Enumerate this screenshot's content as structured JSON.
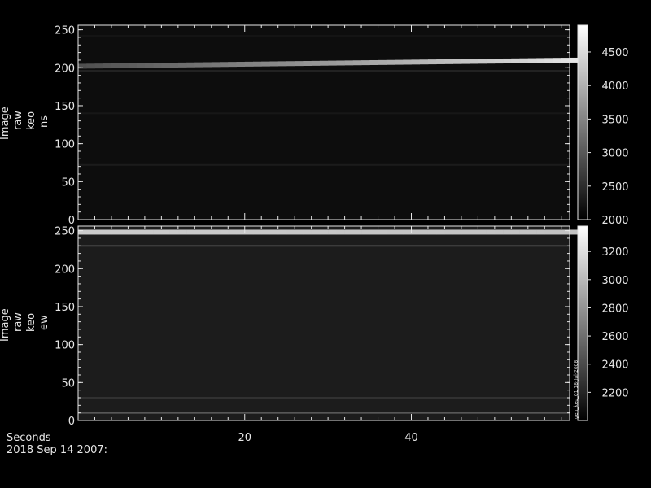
{
  "footer": {
    "xlabel": "Seconds",
    "date": "2018 Sep 14 2007:"
  },
  "chart_data": [
    {
      "type": "heatmap",
      "ylabel": [
        "Image",
        "raw",
        "keo",
        "ns"
      ],
      "xlim": [
        0,
        59
      ],
      "ylim": [
        0,
        256
      ],
      "xticks": [
        20,
        40
      ],
      "yticks": [
        0,
        50,
        100,
        150,
        200,
        250
      ],
      "colorbar": {
        "range": [
          2000,
          4900
        ],
        "ticks": [
          2000,
          2500,
          3000,
          3500,
          4000,
          4500
        ]
      },
      "colormap": "grayscale",
      "background_level": 2150,
      "bright_bands": [
        {
          "y_start": 202,
          "y_end": 210,
          "level_start": 2900,
          "level_end": 4600
        }
      ],
      "faint_bands": [
        {
          "y": 196,
          "level": 2450
        },
        {
          "y": 140,
          "level": 2300
        },
        {
          "y": 72,
          "level": 2350
        },
        {
          "y": 242,
          "level": 2250
        }
      ]
    },
    {
      "type": "heatmap",
      "ylabel": [
        "Image",
        "raw",
        "keo",
        "ew"
      ],
      "xlim": [
        0,
        59
      ],
      "ylim": [
        0,
        256
      ],
      "xticks": [
        20,
        40
      ],
      "yticks": [
        0,
        50,
        100,
        150,
        200,
        250
      ],
      "colorbar": {
        "range": [
          2000,
          3380
        ],
        "ticks": [
          2200,
          2400,
          2600,
          2800,
          3000,
          3200
        ],
        "annotation": "gen_keo_01 18-Jul-2008"
      },
      "colormap": "grayscale",
      "background_level": 2150,
      "bright_bands": [
        {
          "y_start": 248,
          "y_end": 248,
          "level_start": 3100,
          "level_end": 3050
        }
      ],
      "faint_bands": [
        {
          "y": 230,
          "level": 2450
        },
        {
          "y": 10,
          "level": 2550
        },
        {
          "y": 30,
          "level": 2300
        }
      ]
    }
  ]
}
